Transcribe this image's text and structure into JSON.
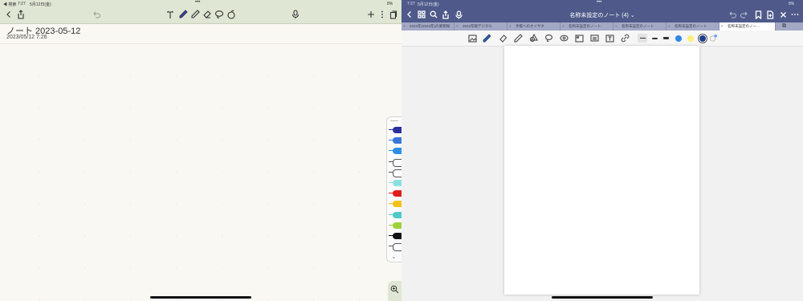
{
  "left": {
    "status": {
      "back_app": "◀ 検索",
      "time": "7:27",
      "date": "5月12日(金)",
      "dots": "•••",
      "battery": "8%"
    },
    "note_title": "ノート 2023-05-12",
    "note_date": "2023/05/12 7:26",
    "palette_colors": [
      "#2b2f9e",
      "#3a75d8",
      "#2f8fe6",
      "#ffffff",
      "#ffffff",
      "#8ee0e0",
      "#e01c1c",
      "#f3c21a",
      "#4fc8c8",
      "#9fd13a",
      "#111111",
      "#ffffff"
    ],
    "icons": [
      "back-icon",
      "share-icon",
      "undo-icon",
      "text-tool-icon",
      "pen-icon",
      "highlighter-icon",
      "eraser-icon",
      "lasso-icon",
      "sticker-icon",
      "mic-icon",
      "add-icon",
      "more-icon",
      "pages-icon",
      "zoom-icon"
    ]
  },
  "right": {
    "status": {
      "time": "7:27",
      "date": "5月12日(金)",
      "dots": "•••",
      "battery": "8%"
    },
    "doc_title": "名称未設定のノート (4) ⌄",
    "tabs": [
      "2023年(2023年)の業務報",
      "2023年版デジタル",
      "手帳へのオイサネ",
      "名称未設定のノート",
      "名称未設定のノート",
      "名称未設定のノート",
      "名称未設定のノー…"
    ],
    "active_tab_index": 6,
    "tool_colors": [
      "#2f86e8",
      "#f8ef7a",
      "#1f3f8a",
      "#6aa7f0"
    ],
    "stroke_widths": [
      "thin",
      "medium",
      "thick"
    ]
  }
}
